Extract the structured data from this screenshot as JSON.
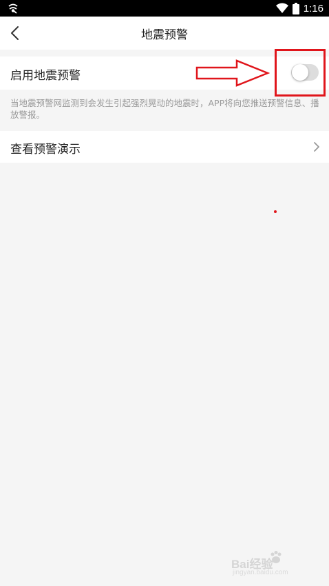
{
  "status_bar": {
    "time": "1:16",
    "icons": [
      "app-notification-icon",
      "wifi-icon",
      "battery-icon"
    ]
  },
  "nav": {
    "title": "地震预警",
    "back_icon": "chevron-left-icon"
  },
  "settings": {
    "enable": {
      "label": "启用地震预警",
      "toggle_on": false
    },
    "description": "当地震预警网监测到会发生引起强烈晃动的地震时，APP将向您推送预警信息、播放警报。",
    "demo": {
      "label": "查看预警演示",
      "chevron_icon": "chevron-right-icon"
    }
  },
  "annotation": {
    "color": "#e0151b",
    "arrow_icon": "right-arrow-outline",
    "box": "highlight-rectangle"
  },
  "watermark": {
    "text": "Bai经验",
    "sub": "jingyan.baidu.com"
  },
  "colors": {
    "background": "#f5f5f5",
    "card": "#ffffff",
    "text_primary": "#222222",
    "text_secondary": "#999999",
    "toggle_off_track": "#dddddd",
    "annotation_red": "#e0151b"
  }
}
